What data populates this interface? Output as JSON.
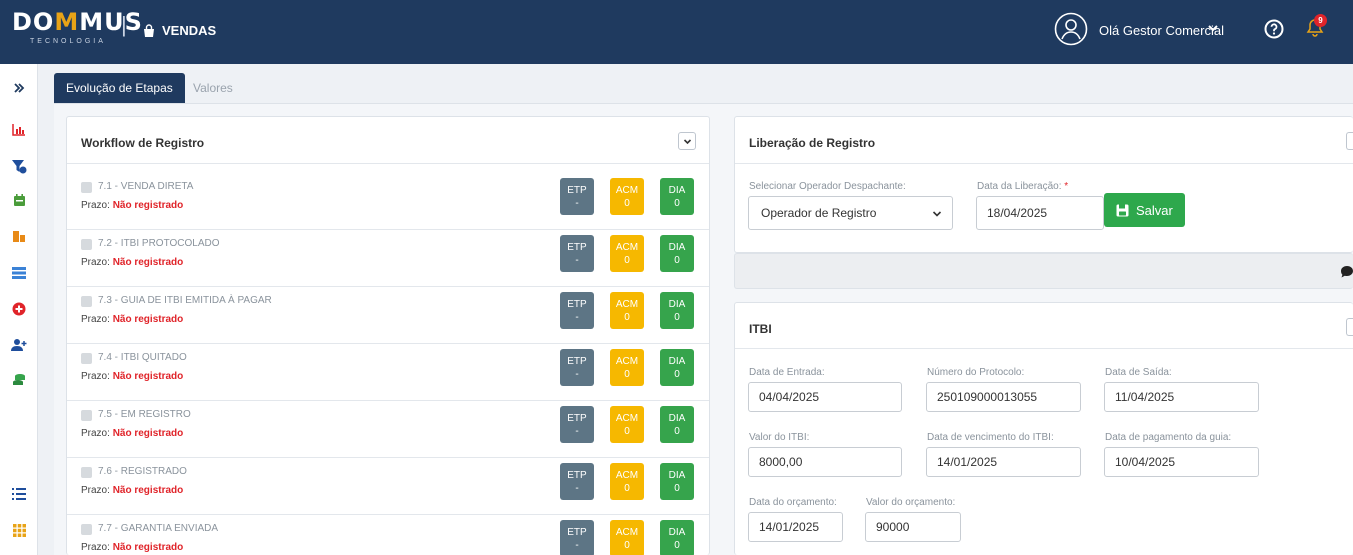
{
  "header": {
    "logo_part1": "DO",
    "logo_part2": "M",
    "logo_part3": "MUS",
    "logo_sub": "TECNOLOGIA",
    "separator": "|",
    "module": "VENDAS",
    "greeting": "Olá Gestor Comercial",
    "notification_count": "9",
    "colors": {
      "bg": "#1f3a5f",
      "accent": "#e8a317"
    }
  },
  "sidebar": {
    "icons": [
      "expand-icon",
      "chart-icon",
      "funnel-icon",
      "calendar-icon",
      "building-icon",
      "table-icon",
      "plus-circle-icon",
      "add-user-icon",
      "coins-icon",
      "list-icon",
      "grid-icon"
    ]
  },
  "tabs": [
    {
      "label": "Evolução de Etapas",
      "active": true
    },
    {
      "label": "Valores",
      "active": false
    }
  ],
  "workflow": {
    "title": "Workflow de Registro",
    "prazo_label": "Prazo:",
    "rows": [
      {
        "name": "7.1 - VENDA DIRETA",
        "prazo": "Não registrado",
        "etp_label": "ETP",
        "etp": "-",
        "acm_label": "ACM",
        "acm": "0",
        "dia_label": "DIA",
        "dia": "0"
      },
      {
        "name": "7.2 - ITBI PROTOCOLADO",
        "prazo": "Não registrado",
        "etp_label": "ETP",
        "etp": "-",
        "acm_label": "ACM",
        "acm": "0",
        "dia_label": "DIA",
        "dia": "0"
      },
      {
        "name": "7.3 - GUIA DE ITBI EMITIDA À PAGAR",
        "prazo": "Não registrado",
        "etp_label": "ETP",
        "etp": "-",
        "acm_label": "ACM",
        "acm": "0",
        "dia_label": "DIA",
        "dia": "0"
      },
      {
        "name": "7.4 - ITBI QUITADO",
        "prazo": "Não registrado",
        "etp_label": "ETP",
        "etp": "-",
        "acm_label": "ACM",
        "acm": "0",
        "dia_label": "DIA",
        "dia": "0"
      },
      {
        "name": "7.5 - EM REGISTRO",
        "prazo": "Não registrado",
        "etp_label": "ETP",
        "etp": "-",
        "acm_label": "ACM",
        "acm": "0",
        "dia_label": "DIA",
        "dia": "0"
      },
      {
        "name": "7.6 - REGISTRADO",
        "prazo": "Não registrado",
        "etp_label": "ETP",
        "etp": "-",
        "acm_label": "ACM",
        "acm": "0",
        "dia_label": "DIA",
        "dia": "0"
      },
      {
        "name": "7.7 - GARANTIA ENVIADA",
        "prazo": "Não registrado",
        "etp_label": "ETP",
        "etp": "-",
        "acm_label": "ACM",
        "acm": "0",
        "dia_label": "DIA",
        "dia": "0"
      }
    ]
  },
  "liberacao": {
    "title": "Liberação de Registro",
    "operador_label": "Selecionar Operador Despachante:",
    "operador_value": "Operador de Registro",
    "data_label": "Data da Liberação:",
    "required_mark": "*",
    "data_value": "18/04/2025",
    "save_label": "Salvar"
  },
  "itbi": {
    "title": "ITBI",
    "fields": {
      "data_entrada": {
        "label": "Data de Entrada:",
        "value": "04/04/2025"
      },
      "numero_protocolo": {
        "label": "Número do Protocolo:",
        "value": "250109000013055"
      },
      "data_saida": {
        "label": "Data de Saída:",
        "value": "11/04/2025"
      },
      "valor_itbi": {
        "label": "Valor do ITBI:",
        "value": "8000,00"
      },
      "data_vencimento": {
        "label": "Data de vencimento do ITBI:",
        "value": "14/01/2025"
      },
      "data_pagamento": {
        "label": "Data de pagamento da guia:",
        "value": "10/04/2025"
      },
      "data_orcamento": {
        "label": "Data do orçamento:",
        "value": "14/01/2025"
      },
      "valor_orcamento": {
        "label": "Valor do orçamento:",
        "value": "90000"
      }
    }
  }
}
